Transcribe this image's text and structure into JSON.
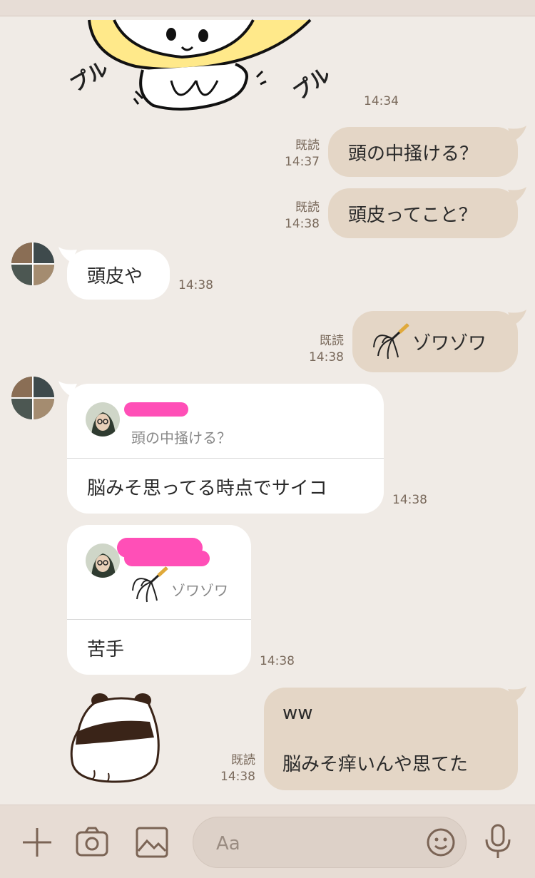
{
  "colors": {
    "background": "#f0ebe6",
    "my_bubble": "#e4d6c6",
    "their_bubble": "#ffffff",
    "meta_text": "#7a6a5c",
    "redaction": "#ff4fb7"
  },
  "messages": [
    {
      "from": "me",
      "type": "sticker",
      "sticker": "bear-shaking-sticker",
      "sticker_text": [
        "プル",
        "プル"
      ],
      "time": "14:34",
      "read": ""
    },
    {
      "from": "me",
      "type": "text",
      "text": "頭の中掻ける？",
      "time": "14:37",
      "read": "既読"
    },
    {
      "from": "me",
      "type": "text",
      "text": "頭皮ってこと？",
      "time": "14:38",
      "read": "既読"
    },
    {
      "from": "them",
      "type": "text",
      "text": "頭皮や",
      "time": "14:38"
    },
    {
      "from": "me",
      "type": "text",
      "emoji": "head-massager-icon",
      "text": "ゾワゾワ",
      "time": "14:38",
      "read": "既読"
    },
    {
      "from": "them",
      "type": "reply",
      "quoted_text": "頭の中掻ける？",
      "text": "脳みそ思ってる時点でサイコ",
      "time": "14:38"
    },
    {
      "from": "them",
      "type": "reply",
      "quoted_emoji": "head-massager-icon",
      "quoted_text": "ゾワゾワ",
      "text": "苦手",
      "time": "14:38"
    },
    {
      "from": "me",
      "type": "text",
      "text_lines": [
        "ww",
        "",
        "脳みそ痒いんや思てた"
      ],
      "time": "14:38",
      "read": "既読"
    },
    {
      "from": "them",
      "type": "sticker",
      "sticker": "panda-sticker"
    }
  ],
  "input": {
    "placeholder": "Aa"
  },
  "toolbar": [
    "plus-icon",
    "camera-icon",
    "image-icon",
    "emoji-icon",
    "mic-icon"
  ]
}
